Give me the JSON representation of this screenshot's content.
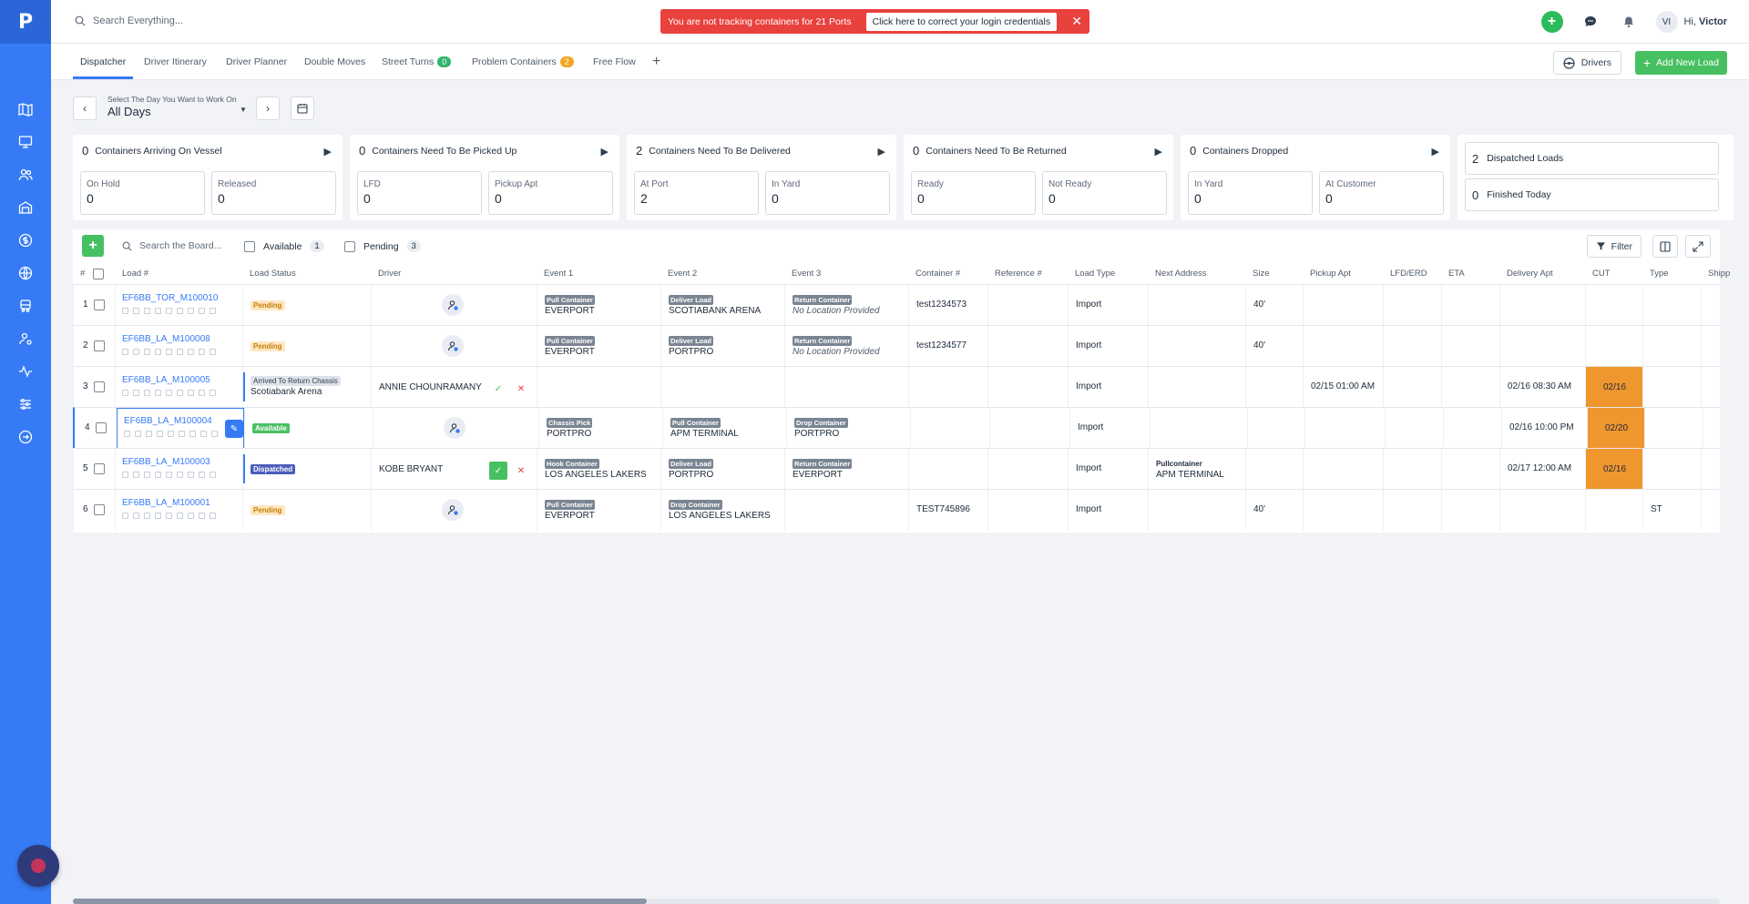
{
  "search_placeholder": "Search Everything...",
  "alert": {
    "message": "You are not tracking containers for 21 Ports",
    "action": "Click here to correct your login credentials",
    "close": "✕"
  },
  "user": {
    "initials": "VI",
    "greeting": "Hi,",
    "name": "Victor"
  },
  "tabs": [
    {
      "label": "Dispatcher"
    },
    {
      "label": "Driver Itinerary"
    },
    {
      "label": "Driver Planner"
    },
    {
      "label": "Double Moves"
    },
    {
      "label": "Street Turns",
      "count": "0"
    },
    {
      "label": "Problem Containers",
      "count": "2"
    },
    {
      "label": "Free Flow"
    }
  ],
  "drivers_button": "Drivers",
  "add_load_button": "Add New Load",
  "day_selector": {
    "label": "Select The Day You Want to Work On",
    "value": "All Days"
  },
  "summary_cards": [
    {
      "count": "0",
      "title": "Containers Arriving On Vessel",
      "subs": [
        {
          "label": "On Hold",
          "value": "0"
        },
        {
          "label": "Released",
          "value": "0"
        }
      ]
    },
    {
      "count": "0",
      "title": "Containers Need To Be Picked Up",
      "subs": [
        {
          "label": "LFD",
          "value": "0"
        },
        {
          "label": "Pickup Apt",
          "value": "0"
        }
      ]
    },
    {
      "count": "2",
      "title": "Containers Need To Be Delivered",
      "subs": [
        {
          "label": "At Port",
          "value": "2"
        },
        {
          "label": "In Yard",
          "value": "0"
        }
      ]
    },
    {
      "count": "0",
      "title": "Containers Need To Be Returned",
      "subs": [
        {
          "label": "Ready",
          "value": "0"
        },
        {
          "label": "Not Ready",
          "value": "0"
        }
      ]
    },
    {
      "count": "0",
      "title": "Containers Dropped",
      "subs": [
        {
          "label": "In Yard",
          "value": "0"
        },
        {
          "label": "At Customer",
          "value": "0"
        }
      ]
    }
  ],
  "totals": [
    {
      "count": "2",
      "label": "Dispatched Loads"
    },
    {
      "count": "0",
      "label": "Finished Today"
    }
  ],
  "board": {
    "search_placeholder": "Search the Board...",
    "available_label": "Available",
    "available_count": "1",
    "pending_label": "Pending",
    "pending_count": "3",
    "filter_label": "Filter"
  },
  "columns": [
    "#",
    "Load #",
    "Load Status",
    "Driver",
    "Event 1",
    "Event 2",
    "Event 3",
    "Container #",
    "Reference #",
    "Load Type",
    "Next Address",
    "Size",
    "Pickup Apt",
    "LFD/ERD",
    "ETA",
    "Delivery Apt",
    "CUT",
    "Type",
    "Shipp"
  ],
  "rows": [
    {
      "num": "1",
      "load": "EF6BB_TOR_M100010",
      "status": "Pending",
      "e1_tag": "Pull Container",
      "e1": "EVERPORT",
      "e2_tag": "Deliver Load",
      "e2": "SCOTIABANK ARENA",
      "e3_tag": "Return Container",
      "e3": "No Location Provided",
      "container": "test1234573",
      "type": "Import",
      "size": "40'"
    },
    {
      "num": "2",
      "load": "EF6BB_LA_M100008",
      "status": "Pending",
      "e1_tag": "Pull Container",
      "e1": "EVERPORT",
      "e2_tag": "Deliver Load",
      "e2": "PORTPRO",
      "e3_tag": "Return Container",
      "e3": "No Location Provided",
      "container": "test1234577",
      "type": "Import",
      "size": "40'"
    },
    {
      "num": "3",
      "load": "EF6BB_LA_M100005",
      "status_tag": "Arrived To Return Chassis",
      "status_loc": "Scotiabank Arena",
      "driver": "ANNIE CHOUNRAMANY",
      "type": "Import",
      "pickup": "02/15 01:00 AM",
      "delivery": "02/16 08:30 AM",
      "cut": "02/16"
    },
    {
      "num": "4",
      "load": "EF6BB_LA_M100004",
      "status": "Available",
      "e1_tag": "Chassis Pick",
      "e1": "PORTPRO",
      "e2_tag": "Pull Container",
      "e2": "APM TERMINAL",
      "e3_tag": "Drop Container",
      "e3": "PORTPRO",
      "type": "Import",
      "delivery": "02/16 10:00 PM",
      "cut": "02/20"
    },
    {
      "num": "5",
      "load": "EF6BB_LA_M100003",
      "status": "Dispatched",
      "driver": "KOBE BRYANT",
      "e1_tag": "Hook Container",
      "e1": "LOS ANGELES LAKERS",
      "e2_tag": "Deliver Load",
      "e2": "PORTPRO",
      "e3_tag": "Return Container",
      "e3": "EVERPORT",
      "type": "Import",
      "next_tag": "Pullcontainer",
      "next": "APM TERMINAL",
      "delivery": "02/17 12:00 AM",
      "cut": "02/16"
    },
    {
      "num": "6",
      "load": "EF6BB_LA_M100001",
      "status": "Pending",
      "e1_tag": "Pull Container",
      "e1": "EVERPORT",
      "e2_tag": "Drop Container",
      "e2": "LOS ANGELES LAKERS",
      "container": "TEST745896",
      "type": "Import",
      "size": "40'",
      "load_type_code": "ST"
    }
  ],
  "colors": {
    "brand": "#367bf5",
    "green": "#47c061",
    "alert": "#e9413e",
    "cut": "#f0962f"
  }
}
